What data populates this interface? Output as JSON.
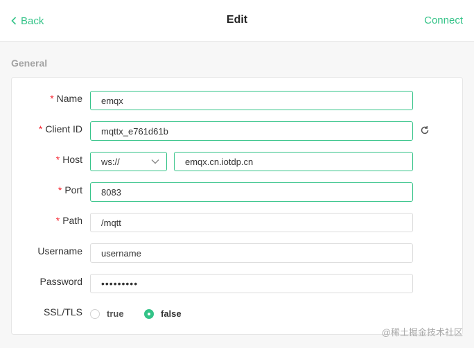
{
  "header": {
    "back_label": "Back",
    "title": "Edit",
    "connect_label": "Connect"
  },
  "section": {
    "title": "General"
  },
  "form": {
    "name": {
      "label": "Name",
      "required": "*",
      "value": "emqx"
    },
    "client_id": {
      "label": "Client ID",
      "required": "*",
      "value": "mqttx_e761d61b",
      "action_icon": "refresh-icon"
    },
    "host": {
      "label": "Host",
      "required": "*",
      "protocol": "ws://",
      "value": "emqx.cn.iotdp.cn"
    },
    "port": {
      "label": "Port",
      "required": "*",
      "value": "8083"
    },
    "path": {
      "label": "Path",
      "required": "*",
      "value": "/mqtt"
    },
    "username": {
      "label": "Username",
      "value": "username"
    },
    "password": {
      "label": "Password",
      "value": "•••••••••"
    },
    "ssl_tls": {
      "label": "SSL/TLS",
      "options": [
        {
          "label": "true",
          "selected": false
        },
        {
          "label": "false",
          "selected": true
        }
      ]
    }
  },
  "watermark": "@稀土掘金技术社区",
  "colors": {
    "accent": "#34c388",
    "required": "#f5222d",
    "section_title": "#a3a3a3"
  }
}
